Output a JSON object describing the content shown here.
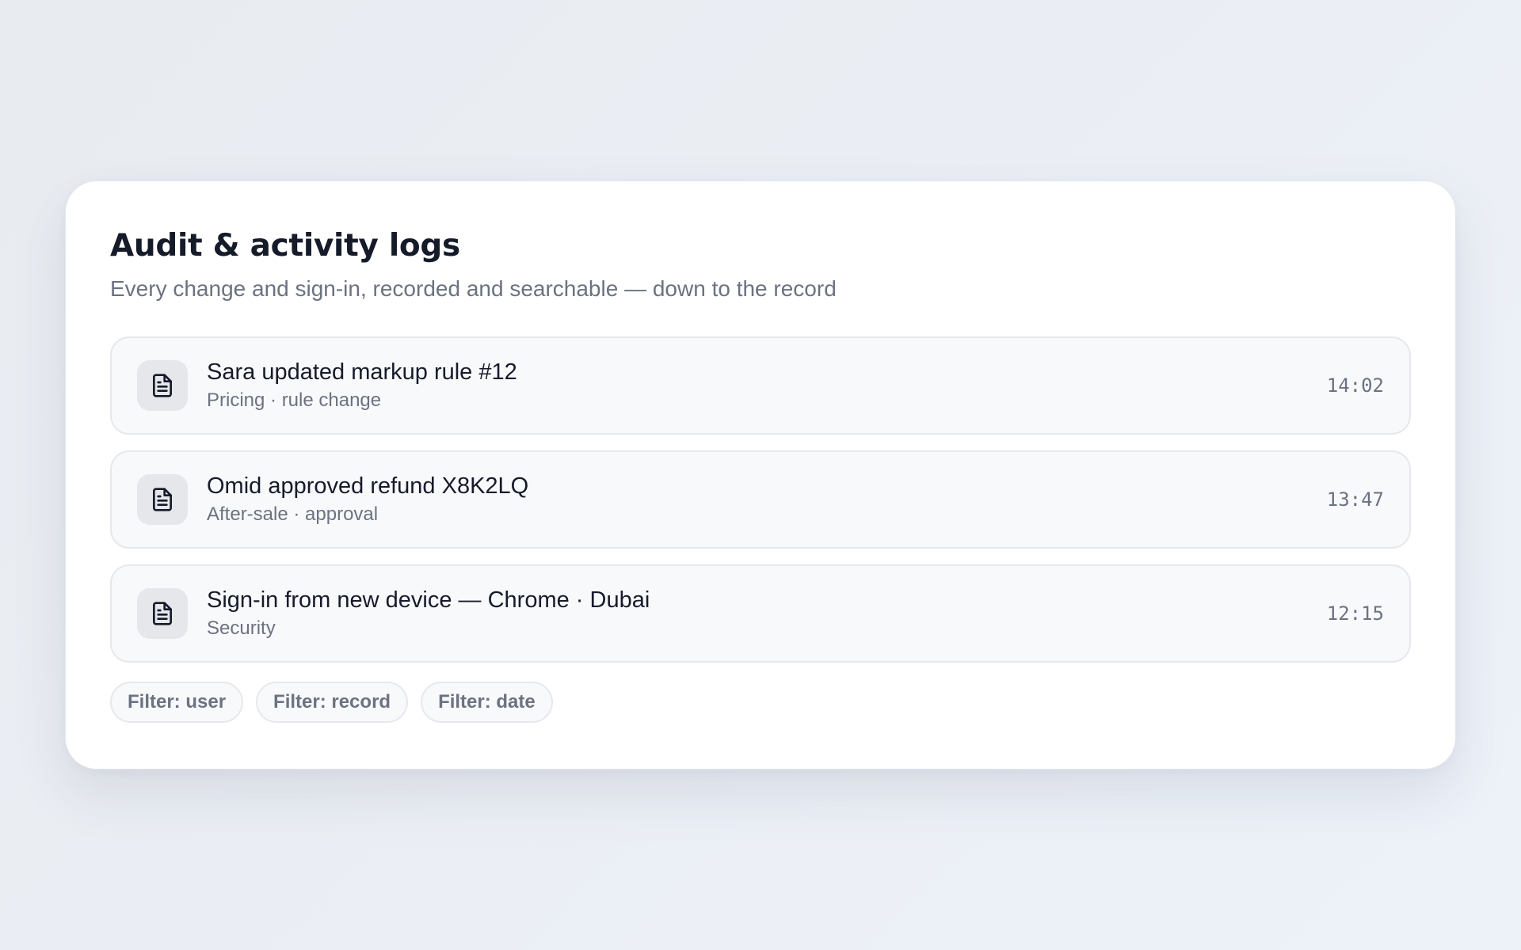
{
  "header": {
    "title": "Audit & activity logs",
    "subtitle": "Every change and sign-in, recorded and searchable — down to the record"
  },
  "logs": [
    {
      "icon": "document-icon",
      "title": "Sara updated markup rule #12",
      "meta": "Pricing · rule change",
      "time": "14:02"
    },
    {
      "icon": "document-icon",
      "title": "Omid approved refund X8K2LQ",
      "meta": "After-sale · approval",
      "time": "13:47"
    },
    {
      "icon": "document-icon",
      "title": "Sign-in from new device — Chrome · Dubai",
      "meta": "Security",
      "time": "12:15"
    }
  ],
  "filters": [
    {
      "label": "Filter: user"
    },
    {
      "label": "Filter: record"
    },
    {
      "label": "Filter: date"
    }
  ],
  "colors": {
    "title": "#161b2a",
    "muted": "#6b7280",
    "row_background": "#f8f9fb",
    "row_border": "#e6e8ee",
    "icon_tile": "#e5e7eb"
  }
}
